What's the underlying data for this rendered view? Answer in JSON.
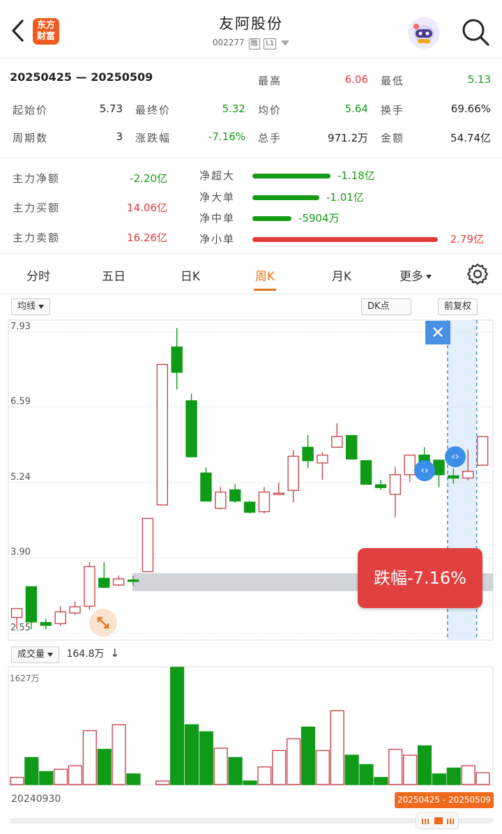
{
  "header": {
    "stock_name": "友阿股份",
    "stock_code": "002277",
    "tag1": "融",
    "tag2": "L1",
    "logo_line1": "东方",
    "logo_line2": "财富"
  },
  "summary": {
    "period": "20250425 — 20250509",
    "high_label": "最高",
    "high_value": "6.06",
    "low_label": "最低",
    "low_value": "5.13",
    "open_label": "起始价",
    "open_value": "5.73",
    "close_label": "最终价",
    "close_value": "5.32",
    "avg_label": "均价",
    "avg_value": "5.64",
    "turnover_label": "换手",
    "turnover_value": "69.66%",
    "periods_label": "周期数",
    "periods_value": "3",
    "change_label": "涨跌幅",
    "change_value": "-7.16%",
    "total_vol_label": "总手",
    "total_vol_value": "971.2万",
    "amount_label": "金额",
    "amount_value": "54.74亿"
  },
  "flow": {
    "main_net_label": "主力净额",
    "main_net_value": "-2.20亿",
    "main_buy_label": "主力买额",
    "main_buy_value": "14.06亿",
    "main_sell_label": "主力卖额",
    "main_sell_value": "16.26亿",
    "items": [
      {
        "label": "净超大",
        "value": "-1.18亿",
        "ratio": 0.42,
        "color": "green"
      },
      {
        "label": "净大单",
        "value": "-1.01亿",
        "ratio": 0.36,
        "color": "green"
      },
      {
        "label": "净中单",
        "value": "-5904万",
        "ratio": 0.21,
        "color": "green"
      },
      {
        "label": "净小单",
        "value": "2.79亿",
        "ratio": 1.0,
        "color": "red"
      }
    ]
  },
  "tabs": [
    {
      "label": "分时",
      "active": false
    },
    {
      "label": "五日",
      "active": false
    },
    {
      "label": "日K",
      "active": false
    },
    {
      "label": "周K",
      "active": true
    },
    {
      "label": "月K",
      "active": false
    },
    {
      "label": "更多",
      "active": false
    }
  ],
  "toolbar": {
    "ma_label": "均线",
    "dk_label": "DK点",
    "adjust_label": "前复权"
  },
  "volume": {
    "indicator_label": "成交量",
    "current_value": "164.8万",
    "max_label": "1627万"
  },
  "tooltip": {
    "change_text": "跌幅-7.16%"
  },
  "axis": {
    "start_date": "20240930",
    "range_label": "20250425 - 20250509"
  },
  "chart_data": {
    "type": "candlestick",
    "y_ticks": [
      "7.93",
      "6.59",
      "5.24",
      "3.90",
      "2.55"
    ],
    "ylim": [
      2.55,
      7.93
    ],
    "candles": [
      {
        "o": 2.83,
        "c": 2.99,
        "h": 3.0,
        "l": 2.63,
        "up": true
      },
      {
        "o": 3.38,
        "c": 2.75,
        "h": 3.38,
        "l": 2.62,
        "up": false
      },
      {
        "o": 2.74,
        "c": 2.69,
        "h": 2.8,
        "l": 2.62,
        "up": false
      },
      {
        "o": 2.72,
        "c": 2.93,
        "h": 3.03,
        "l": 2.68,
        "up": true
      },
      {
        "o": 2.91,
        "c": 3.02,
        "h": 3.12,
        "l": 2.88,
        "up": true
      },
      {
        "o": 3.03,
        "c": 3.74,
        "h": 3.82,
        "l": 2.97,
        "up": true
      },
      {
        "o": 3.53,
        "c": 3.37,
        "h": 3.82,
        "l": 3.35,
        "up": false
      },
      {
        "o": 3.41,
        "c": 3.52,
        "h": 3.58,
        "l": 3.39,
        "up": true
      },
      {
        "o": 3.5,
        "c": 3.5,
        "h": 3.57,
        "l": 3.4,
        "up": false
      },
      {
        "o": 3.65,
        "c": 4.6,
        "h": 4.6,
        "l": 3.65,
        "up": true
      },
      {
        "o": 4.84,
        "c": 7.35,
        "h": 7.35,
        "l": 4.84,
        "up": true
      },
      {
        "o": 7.66,
        "c": 7.21,
        "h": 8.0,
        "l": 6.9,
        "up": false
      },
      {
        "o": 6.7,
        "c": 5.7,
        "h": 6.83,
        "l": 5.7,
        "up": false
      },
      {
        "o": 5.41,
        "c": 4.91,
        "h": 5.51,
        "l": 4.91,
        "up": false
      },
      {
        "o": 4.78,
        "c": 5.07,
        "h": 5.16,
        "l": 4.76,
        "up": true
      },
      {
        "o": 5.11,
        "c": 4.91,
        "h": 5.21,
        "l": 4.88,
        "up": false
      },
      {
        "o": 4.89,
        "c": 4.71,
        "h": 4.91,
        "l": 4.69,
        "up": false
      },
      {
        "o": 4.72,
        "c": 5.07,
        "h": 5.16,
        "l": 4.69,
        "up": true
      },
      {
        "o": 5.05,
        "c": 5.04,
        "h": 5.24,
        "l": 5.03,
        "up": true
      },
      {
        "o": 5.1,
        "c": 5.71,
        "h": 5.82,
        "l": 4.89,
        "up": true
      },
      {
        "o": 5.87,
        "c": 5.63,
        "h": 6.09,
        "l": 5.5,
        "up": false
      },
      {
        "o": 5.59,
        "c": 5.73,
        "h": 5.78,
        "l": 5.29,
        "up": true
      },
      {
        "o": 6.06,
        "c": 5.87,
        "h": 6.3,
        "l": 5.87,
        "up": true
      },
      {
        "o": 6.08,
        "c": 5.66,
        "h": 6.08,
        "l": 5.66,
        "up": false
      },
      {
        "o": 5.63,
        "c": 5.21,
        "h": 5.63,
        "l": 5.21,
        "up": false
      },
      {
        "o": 5.2,
        "c": 5.15,
        "h": 5.29,
        "l": 5.11,
        "up": false
      },
      {
        "o": 5.03,
        "c": 5.38,
        "h": 5.52,
        "l": 4.62,
        "up": true
      },
      {
        "o": 5.38,
        "c": 5.73,
        "h": 5.73,
        "l": 5.25,
        "up": true
      },
      {
        "o": 5.73,
        "c": 5.6,
        "h": 5.87,
        "l": 5.55,
        "up": false
      },
      {
        "o": 5.64,
        "c": 5.38,
        "h": 5.64,
        "l": 5.16,
        "up": false
      },
      {
        "o": 5.36,
        "c": 5.32,
        "h": 5.49,
        "l": 5.22,
        "up": false
      },
      {
        "o": 5.32,
        "c": 5.44,
        "h": 5.83,
        "l": 5.28,
        "up": true
      },
      {
        "o": 5.55,
        "c": 6.06,
        "h": 6.06,
        "l": 5.55,
        "up": true
      }
    ],
    "volumes": [
      {
        "v": 0.06,
        "up": true
      },
      {
        "v": 0.23,
        "up": false
      },
      {
        "v": 0.11,
        "up": false
      },
      {
        "v": 0.13,
        "up": true
      },
      {
        "v": 0.16,
        "up": true
      },
      {
        "v": 0.46,
        "up": true
      },
      {
        "v": 0.3,
        "up": false
      },
      {
        "v": 0.51,
        "up": true
      },
      {
        "v": 0.09,
        "up": false
      },
      {
        "v": 0.0,
        "up": true
      },
      {
        "v": 0.03,
        "up": true
      },
      {
        "v": 1.0,
        "up": false
      },
      {
        "v": 0.51,
        "up": false
      },
      {
        "v": 0.45,
        "up": false
      },
      {
        "v": 0.31,
        "up": true
      },
      {
        "v": 0.23,
        "up": false
      },
      {
        "v": 0.03,
        "up": false
      },
      {
        "v": 0.15,
        "up": true
      },
      {
        "v": 0.29,
        "up": true
      },
      {
        "v": 0.39,
        "up": true
      },
      {
        "v": 0.49,
        "up": false
      },
      {
        "v": 0.29,
        "up": true
      },
      {
        "v": 0.63,
        "up": true
      },
      {
        "v": 0.25,
        "up": false
      },
      {
        "v": 0.17,
        "up": false
      },
      {
        "v": 0.06,
        "up": false
      },
      {
        "v": 0.3,
        "up": true
      },
      {
        "v": 0.25,
        "up": true
      },
      {
        "v": 0.33,
        "up": false
      },
      {
        "v": 0.09,
        "up": false
      },
      {
        "v": 0.14,
        "up": false
      },
      {
        "v": 0.16,
        "up": true
      },
      {
        "v": 0.1,
        "up": true
      }
    ],
    "support_zone": [
      3.3,
      3.62
    ],
    "selected_range": [
      30,
      32
    ]
  }
}
